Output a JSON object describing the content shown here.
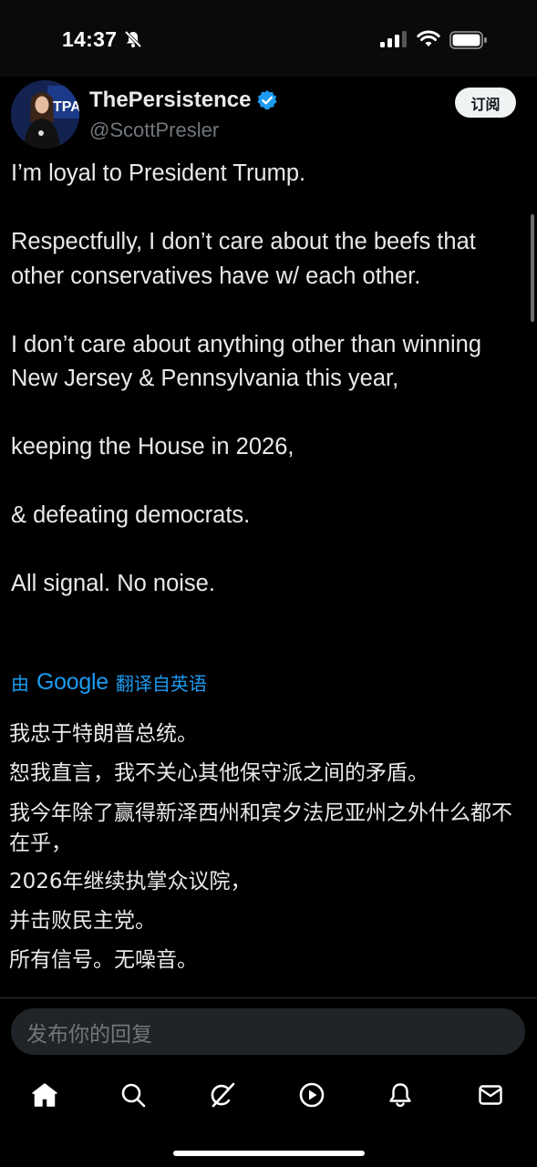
{
  "status_bar": {
    "time": "14:37"
  },
  "author": {
    "display_name": "ThePersistence",
    "handle": "@ScottPresler",
    "verified": true,
    "avatar_logo_text": "TPA"
  },
  "header": {
    "subscribe_label": "订阅"
  },
  "tweet": {
    "paragraphs": [
      "I’m loyal to President Trump.",
      "Respectfully, I don’t care about the beefs that other conservatives have w/ each other.",
      "I don’t care about anything other than winning New Jersey & Pennsylvania this year,",
      "keeping the House in 2026,",
      "& defeating democrats.",
      "All signal. No noise."
    ]
  },
  "translation": {
    "prefix": "由",
    "provider": "Google",
    "suffix": "翻译自英语",
    "lines": [
      "我忠于特朗普总统。",
      "恕我直言，我不关心其他保守派之间的矛盾。",
      "我今年除了赢得新泽西州和宾夕法尼亚州之外什么都不在乎，",
      "2026年继续执掌众议院，",
      "并击败民主党。",
      "所有信号。无噪音。"
    ]
  },
  "reply": {
    "placeholder": "发布你的回复"
  },
  "nav": {
    "items": [
      {
        "icon": "home-icon"
      },
      {
        "icon": "search-icon"
      },
      {
        "icon": "grok-icon"
      },
      {
        "icon": "video-icon"
      },
      {
        "icon": "notifications-icon"
      },
      {
        "icon": "messages-icon"
      }
    ]
  },
  "colors": {
    "accent": "#1d9bf0",
    "background": "#000000",
    "text": "#e7e9ea",
    "muted": "#71767b"
  }
}
